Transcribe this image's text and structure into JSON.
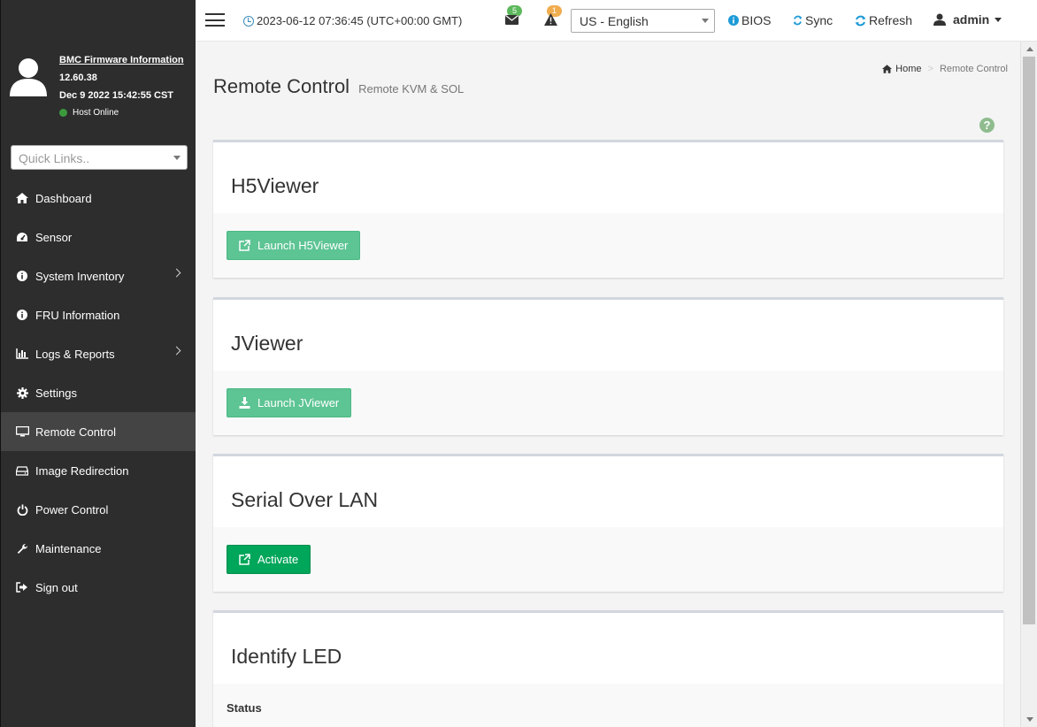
{
  "sidebar": {
    "firmware_title": "BMC Firmware Information",
    "firmware_version": "12.60.38",
    "firmware_date": "Dec 9 2022 15:42:55 CST",
    "host_status": "Host Online",
    "quick_links_placeholder": "Quick Links..",
    "items": [
      {
        "label": "Dashboard",
        "icon": "home-icon"
      },
      {
        "label": "Sensor",
        "icon": "dashboard-gauge-icon"
      },
      {
        "label": "System Inventory",
        "icon": "info-icon"
      },
      {
        "label": "FRU Information",
        "icon": "info-icon"
      },
      {
        "label": "Logs & Reports",
        "icon": "bar-chart-icon"
      },
      {
        "label": "Settings",
        "icon": "gear-icon"
      },
      {
        "label": "Remote Control",
        "icon": "monitor-icon"
      },
      {
        "label": "Image Redirection",
        "icon": "drive-icon"
      },
      {
        "label": "Power Control",
        "icon": "power-icon"
      },
      {
        "label": "Maintenance",
        "icon": "wrench-icon"
      },
      {
        "label": "Sign out",
        "icon": "sign-out-icon"
      }
    ]
  },
  "header": {
    "datetime": "2023-06-12 07:36:45 (UTC+00:00 GMT)",
    "messages_count": "5",
    "alerts_count": "1",
    "language": "US - English",
    "bios_label": "BIOS",
    "sync_label": "Sync",
    "refresh_label": "Refresh",
    "user_label": "admin"
  },
  "page": {
    "title": "Remote Control",
    "subtitle": "Remote KVM & SOL",
    "breadcrumb_home": "Home",
    "breadcrumb_current": "Remote Control",
    "help_icon_text": "?"
  },
  "sections": {
    "h5viewer": {
      "title": "H5Viewer",
      "button": "Launch H5Viewer"
    },
    "jviewer": {
      "title": "JViewer",
      "button": "Launch JViewer"
    },
    "sol": {
      "title": "Serial Over LAN",
      "button": "Activate"
    },
    "led": {
      "title": "Identify LED",
      "status_label": "Status"
    }
  },
  "colors": {
    "sidebar_bg": "#2d2d2d",
    "button_light_green": "#5dc494",
    "button_green": "#00a65a",
    "host_online": "#3c9a3c",
    "badge_green": "#5cb85c",
    "badge_orange": "#f0ad4e"
  }
}
